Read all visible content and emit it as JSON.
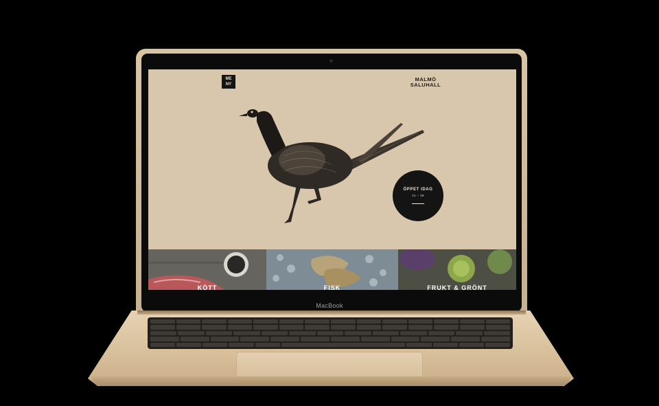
{
  "laptop": {
    "brand": "MacBook"
  },
  "site": {
    "menu_button": "ME\nNY",
    "logo": [
      "MALMÖ",
      "SALUHALL"
    ],
    "opening": {
      "title": "ÖPPET IDAG",
      "hours": "11 – 16"
    },
    "categories": [
      {
        "label": "KÖTT"
      },
      {
        "label": "FISK"
      },
      {
        "label": "FRUKT & GRÖNT"
      }
    ]
  }
}
